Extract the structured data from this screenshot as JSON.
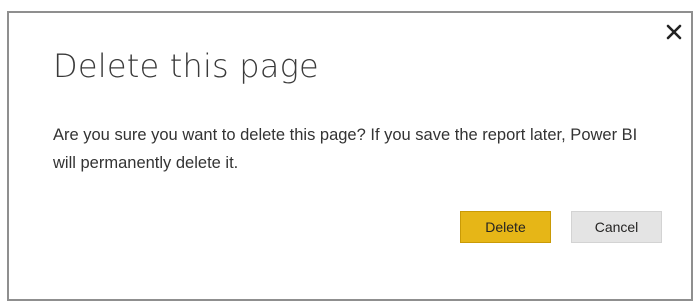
{
  "dialog": {
    "title": "Delete this page",
    "message": "Are you sure you want to delete this page? If you save the report later, Power BI will permanently delete it.",
    "delete_label": "Delete",
    "cancel_label": "Cancel",
    "close_icon": "close-icon"
  },
  "colors": {
    "delete_button": "#e6b617",
    "cancel_button": "#e4e4e4",
    "dialog_border": "#8f8f8f"
  }
}
